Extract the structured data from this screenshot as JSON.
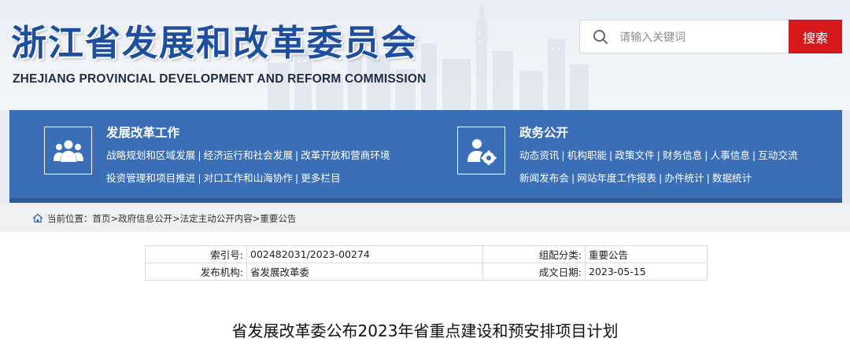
{
  "header": {
    "title": "浙江省发展和改革委员会",
    "subtitle": "ZHEJIANG PROVINCIAL DEVELOPMENT AND REFORM COMMISSION",
    "search_placeholder": "请输入关键词",
    "search_button": "搜索"
  },
  "nav": {
    "block1": {
      "heading": "发展改革工作",
      "icon": "people-group-icon",
      "line1": [
        "战略规划和区域发展",
        "经济运行和社会发展",
        "改革开放和营商环境"
      ],
      "line2": [
        "投资管理和项目推进",
        "对口工作和山海协作",
        "更多栏目"
      ]
    },
    "block2": {
      "heading": "政务公开",
      "icon": "user-settings-icon",
      "line1": [
        "动态资讯",
        "机构职能",
        "政策文件",
        "财务信息",
        "人事信息",
        "互动交流"
      ],
      "line2": [
        "新闻发布会",
        "网站年度工作报表",
        "办件统计",
        "数据统计"
      ]
    },
    "separator": "|"
  },
  "breadcrumb": {
    "label": "当前位置：",
    "items": [
      "首页",
      "政府信息公开",
      "法定主动公开内容",
      "重要公告"
    ],
    "separator": ">"
  },
  "info": {
    "index_label": "索引号:",
    "index_value": "002482031/2023-00274",
    "category_label": "组配分类:",
    "category_value": "重要公告",
    "publisher_label": "发布机构:",
    "publisher_value": "省发展改革委",
    "date_label": "成文日期:",
    "date_value": "2023-05-15"
  },
  "article": {
    "title": "省发展改革委公布2023年省重点建设和预安排项目计划"
  },
  "colors": {
    "title_blue": "#1d4f9e",
    "nav_blue": "#3a6fb7",
    "search_red": "#d6191d"
  }
}
